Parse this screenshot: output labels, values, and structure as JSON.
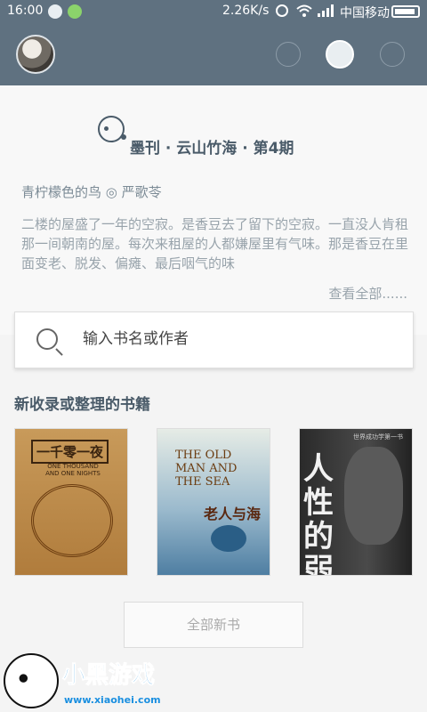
{
  "status_bar": {
    "time": "16:00",
    "network_speed": "2.26K/s",
    "carrier": "中国移动"
  },
  "header": {
    "avatar_icon": "user-avatar",
    "page_indicators": 3,
    "active_page": 2
  },
  "featured": {
    "magazine_title": "墨刊 · 云山竹海 · 第4期",
    "article_byline": "青柠檬色的鸟 ◎ 严歌苓",
    "article_excerpt": "二楼的屋盛了一年的空寂。是香豆去了留下的空寂。一直没人肯租那一间朝南的屋。每次来租屋的人都嫌屋里有气味。那是香豆在里面变老、脱发、偏瘫、最后咽气的味",
    "view_all_label": "查看全部......"
  },
  "search": {
    "placeholder": "输入书名或作者"
  },
  "new_books": {
    "section_title": "新收录或整理的书籍",
    "books": [
      {
        "cover_title": "一千零一夜",
        "cover_subtitle": "ONE THOUSAND AND ONE NIGHTS"
      },
      {
        "cover_title": "老人与海",
        "cover_subtitle": "THE OLD MAN AND THE SEA"
      },
      {
        "cover_title": "人性的弱点",
        "cover_subtitle": "世界成功学第一书"
      }
    ],
    "all_new_button_label": "全部新书"
  },
  "watermark": {
    "logo_text": "小黑游戏",
    "url": "www.xiaohei.com"
  },
  "colors": {
    "header_bg": "#5f7180",
    "title_text": "#4a5b69",
    "muted_text": "#98a3ab"
  }
}
